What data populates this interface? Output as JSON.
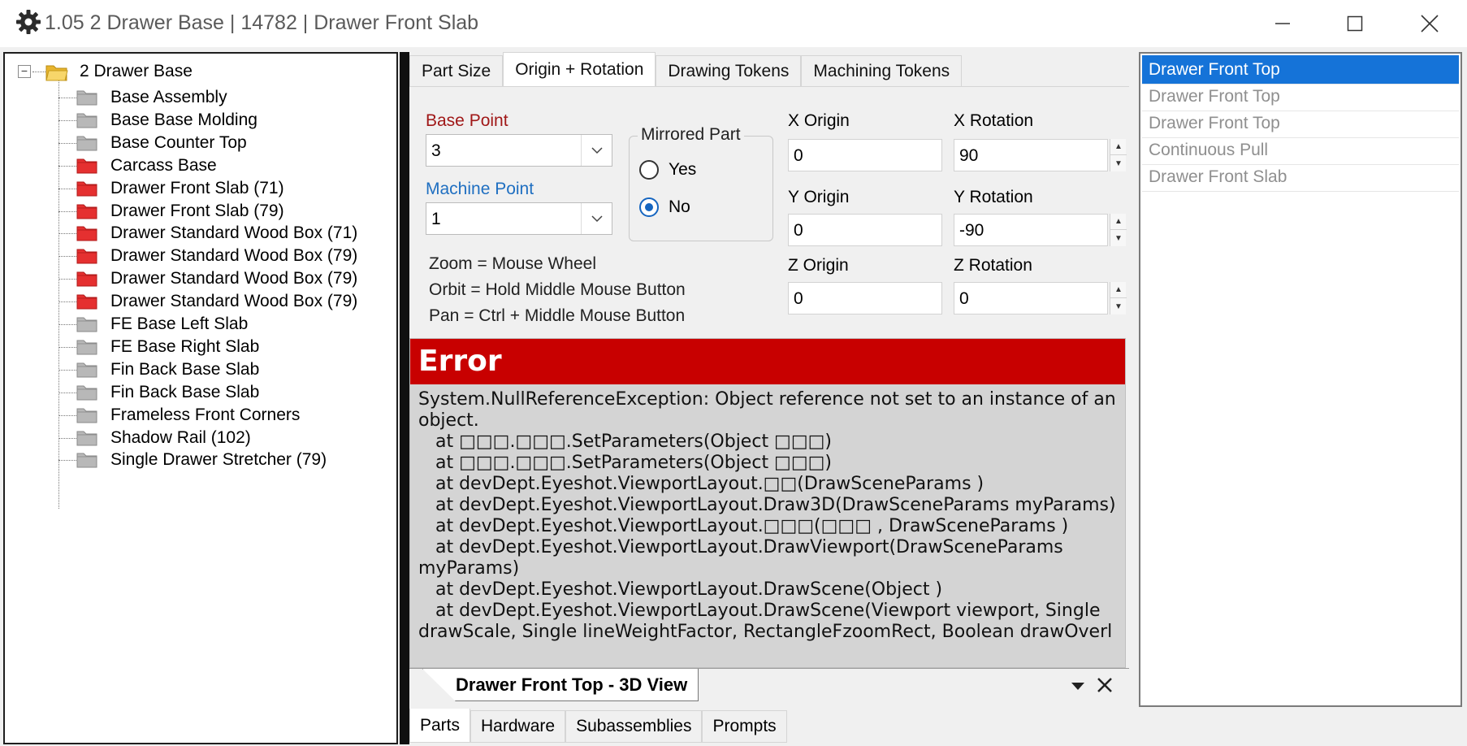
{
  "window": {
    "title": "1.05 2 Drawer Base | 14782 | Drawer Front Slab"
  },
  "tree": {
    "root": "2 Drawer Base",
    "items": [
      {
        "label": "Base Assembly",
        "color": "gray"
      },
      {
        "label": "Base Base Molding",
        "color": "gray"
      },
      {
        "label": "Base Counter Top",
        "color": "gray"
      },
      {
        "label": "Carcass Base",
        "color": "red"
      },
      {
        "label": "Drawer Front Slab (71)",
        "color": "red"
      },
      {
        "label": "Drawer Front Slab (79)",
        "color": "red"
      },
      {
        "label": "Drawer Standard Wood Box (71)",
        "color": "red"
      },
      {
        "label": "Drawer Standard Wood Box (79)",
        "color": "red"
      },
      {
        "label": "Drawer Standard Wood Box (79)",
        "color": "red"
      },
      {
        "label": "Drawer Standard Wood Box (79)",
        "color": "red"
      },
      {
        "label": "FE Base Left Slab",
        "color": "gray"
      },
      {
        "label": "FE Base Right Slab",
        "color": "gray"
      },
      {
        "label": "Fin Back Base Slab",
        "color": "gray"
      },
      {
        "label": "Fin Back Base Slab",
        "color": "gray"
      },
      {
        "label": "Frameless Front Corners",
        "color": "gray"
      },
      {
        "label": "Shadow Rail (102)",
        "color": "gray"
      },
      {
        "label": "Single Drawer Stretcher (79)",
        "color": "gray"
      }
    ]
  },
  "tabs": [
    "Part  Size",
    "Origin + Rotation",
    "Drawing Tokens",
    "Machining Tokens"
  ],
  "active_tab": "Origin + Rotation",
  "origin": {
    "base_point_label": "Base Point",
    "base_point_value": "3",
    "machine_point_label": "Machine Point",
    "machine_point_value": "1",
    "mirrored_label": "Mirrored Part",
    "yes_label": "Yes",
    "no_label": "No",
    "mirrored_selected": "No",
    "hints": [
      "Zoom = Mouse Wheel",
      "Orbit = Hold Middle Mouse Button",
      "Pan = Ctrl + Middle Mouse Button"
    ],
    "x_origin_label": "X Origin",
    "x_origin": "0",
    "y_origin_label": "Y Origin",
    "y_origin": "0",
    "z_origin_label": "Z Origin",
    "z_origin": "0",
    "x_rotation_label": "X Rotation",
    "x_rotation": "90",
    "y_rotation_label": "Y Rotation",
    "y_rotation": "-90",
    "z_rotation_label": "Z Rotation",
    "z_rotation": "0"
  },
  "error": {
    "title": "Error",
    "message": "System.NullReferenceException: Object reference not set to an instance of an object.\n   at □□□.□□□.SetParameters(Object □□□)\n   at □□□.□□□.SetParameters(Object □□□)\n   at devDept.Eyeshot.ViewportLayout.□□(DrawSceneParams )\n   at devDept.Eyeshot.ViewportLayout.Draw3D(DrawSceneParams myParams)\n   at devDept.Eyeshot.ViewportLayout.□□□(□□□ , DrawSceneParams )\n   at devDept.Eyeshot.ViewportLayout.DrawViewport(DrawSceneParams myParams)\n   at devDept.Eyeshot.ViewportLayout.DrawScene(Object )\n   at devDept.Eyeshot.ViewportLayout.DrawScene(Viewport viewport, Single drawScale, Single lineWeightFactor, RectangleFzoomRect, Boolean drawOverl"
  },
  "view_tab": {
    "label": "Drawer Front Top - 3D View"
  },
  "bottom_tabs": [
    "Parts",
    "Hardware",
    "Subassemblies",
    "Prompts"
  ],
  "active_bottom_tab": "Parts",
  "right_list": {
    "items": [
      "Drawer Front Top",
      "Drawer Front Top",
      "Drawer Front Top",
      "Continuous Pull",
      "Drawer Front Slab"
    ],
    "selected_index": 0
  },
  "colors": {
    "error_header": "#c80000",
    "selection": "#1573d8",
    "base_point_label": "#a01818",
    "machine_point_label": "#1f6fc1",
    "folder_red": "#e53030",
    "folder_gray": "#b8b8b8",
    "folder_yellow": "#f5c542"
  }
}
